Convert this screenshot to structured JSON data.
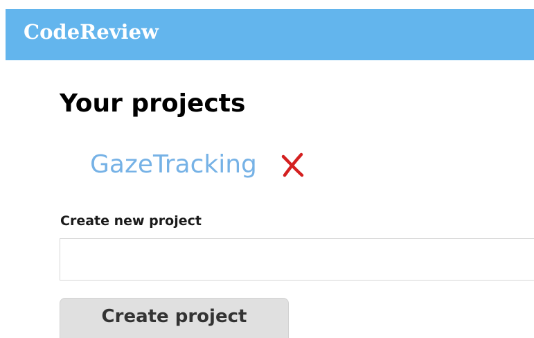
{
  "app": {
    "brand": "CodeReview"
  },
  "main": {
    "title": "Your projects",
    "projects": [
      {
        "name": "GazeTracking",
        "delete_icon": "close-x-icon"
      }
    ],
    "new_project": {
      "label": "Create new project",
      "value": "",
      "placeholder": "",
      "submit_label": "Create project"
    }
  },
  "colors": {
    "header_bg": "#63b5ed",
    "link": "#76b2e6",
    "delete_icon": "#d42020",
    "button_bg": "#e0e0e0"
  }
}
